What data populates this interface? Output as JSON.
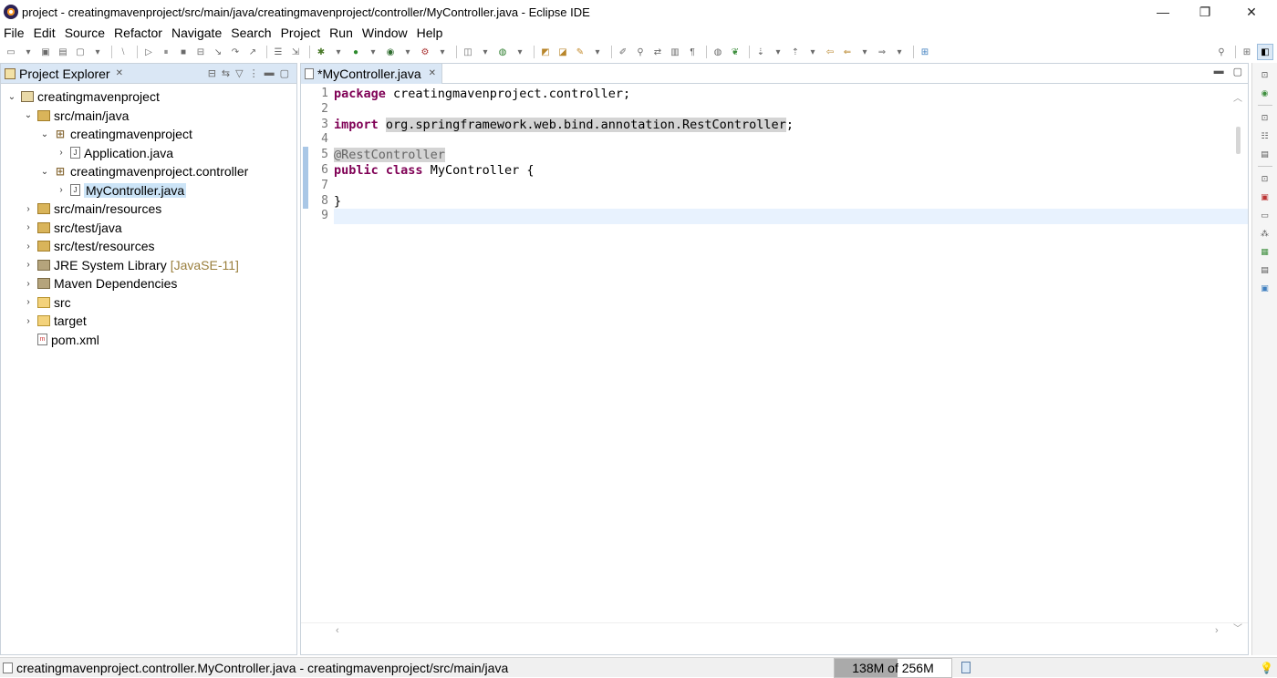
{
  "window": {
    "title": "project - creatingmavenproject/src/main/java/creatingmavenproject/controller/MyController.java - Eclipse IDE",
    "minimize_glyph": "—",
    "maximize_glyph": "❐",
    "close_glyph": "✕"
  },
  "menu": [
    "File",
    "Edit",
    "Source",
    "Refactor",
    "Navigate",
    "Search",
    "Project",
    "Run",
    "Window",
    "Help"
  ],
  "explorer": {
    "title": "Project Explorer",
    "close_glyph": "✕",
    "tree": [
      {
        "label": "creatingmavenproject",
        "depth": 0,
        "expanded": true,
        "icon": "project-icon"
      },
      {
        "label": "src/main/java",
        "depth": 1,
        "expanded": true,
        "icon": "source-folder-icon"
      },
      {
        "label": "creatingmavenproject",
        "depth": 2,
        "expanded": true,
        "icon": "package-icon"
      },
      {
        "label": "Application.java",
        "depth": 3,
        "expanded": false,
        "icon": "java-file-icon"
      },
      {
        "label": "creatingmavenproject.controller",
        "depth": 2,
        "expanded": true,
        "icon": "package-icon"
      },
      {
        "label": "MyController.java",
        "depth": 3,
        "expanded": false,
        "icon": "java-file-icon",
        "selected": true
      },
      {
        "label": "src/main/resources",
        "depth": 1,
        "expanded": false,
        "icon": "source-folder-icon"
      },
      {
        "label": "src/test/java",
        "depth": 1,
        "expanded": false,
        "icon": "source-folder-icon"
      },
      {
        "label": "src/test/resources",
        "depth": 1,
        "expanded": false,
        "icon": "source-folder-icon"
      },
      {
        "label": "JRE System Library",
        "suffix": "[JavaSE-11]",
        "depth": 1,
        "expanded": false,
        "icon": "library-icon"
      },
      {
        "label": "Maven Dependencies",
        "depth": 1,
        "expanded": false,
        "icon": "library-icon"
      },
      {
        "label": "src",
        "depth": 1,
        "expanded": false,
        "icon": "folder-icon"
      },
      {
        "label": "target",
        "depth": 1,
        "expanded": false,
        "icon": "folder-icon"
      },
      {
        "label": "pom.xml",
        "depth": 1,
        "leaf": true,
        "icon": "xml-file-icon"
      }
    ]
  },
  "editor": {
    "tab_label": "*MyController.java",
    "close_glyph": "✕",
    "current_line": 9,
    "lines": [
      {
        "num": "1",
        "tokens": [
          {
            "t": "package",
            "c": "kw"
          },
          {
            "t": " creatingmavenproject.controller;"
          }
        ]
      },
      {
        "num": "2",
        "tokens": []
      },
      {
        "num": "3",
        "tokens": [
          {
            "t": "import",
            "c": "kw"
          },
          {
            "t": " "
          },
          {
            "t": "org.springframework.web.bind.annotation.RestController",
            "c": "hl"
          },
          {
            "t": ";"
          }
        ]
      },
      {
        "num": "4",
        "tokens": []
      },
      {
        "num": "5",
        "tokens": [
          {
            "t": "@RestController",
            "c": "anno"
          }
        ]
      },
      {
        "num": "6",
        "tokens": [
          {
            "t": "public",
            "c": "kw"
          },
          {
            "t": " "
          },
          {
            "t": "class",
            "c": "kw"
          },
          {
            "t": " MyController {"
          }
        ]
      },
      {
        "num": "7",
        "tokens": []
      },
      {
        "num": "8",
        "tokens": [
          {
            "t": "}"
          }
        ]
      },
      {
        "num": "9",
        "tokens": []
      }
    ]
  },
  "status": {
    "text": "creatingmavenproject.controller.MyController.java - creatingmavenproject/src/main/java",
    "heap_used": "138M",
    "heap_total": "256M",
    "heap_label": "138M of 256M",
    "heap_fraction": 0.539
  },
  "colors": {
    "keyword": "#7f0055",
    "annotation": "#646464",
    "current_line": "#e8f2fe",
    "selection": "#cce4f7",
    "active_tab": "#dae7f5"
  }
}
